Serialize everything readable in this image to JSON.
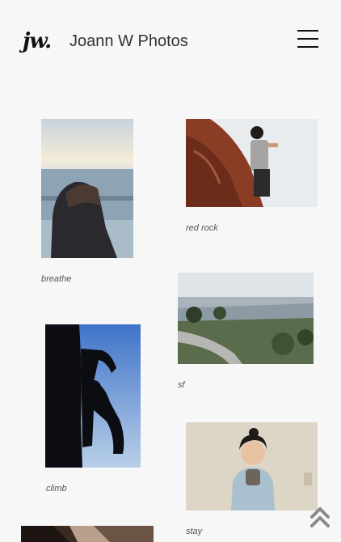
{
  "header": {
    "logo_text": "jw.",
    "title": "Joann W Photos",
    "menu_icon": "hamburger-menu-icon"
  },
  "gallery": {
    "photos": [
      {
        "caption": "breathe"
      },
      {
        "caption": "red rock"
      },
      {
        "caption": "sf"
      },
      {
        "caption": "climb"
      },
      {
        "caption": "stay"
      }
    ]
  },
  "scroll_top_icon": "double-chevron-up-icon",
  "colors": {
    "background": "#f7f7f7",
    "text": "#333333",
    "accent": "#8a8a8a"
  }
}
